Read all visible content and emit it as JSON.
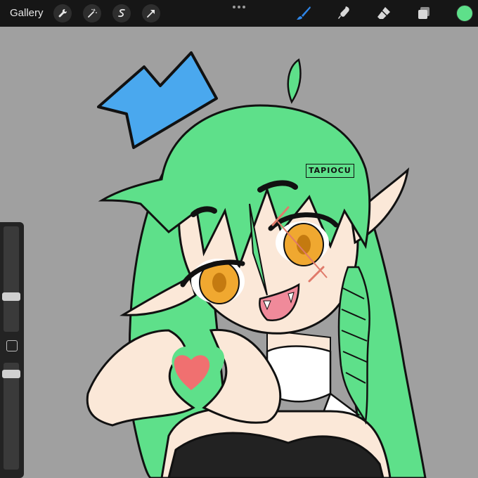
{
  "topbar": {
    "gallery_label": "Gallery",
    "left_tools": [
      {
        "icon": "wrench-icon"
      },
      {
        "icon": "magic-wand-icon"
      },
      {
        "icon": "selection-icon"
      },
      {
        "icon": "transform-arrow-icon"
      }
    ],
    "right_tools": [
      {
        "icon": "brush-icon",
        "active": true
      },
      {
        "icon": "smudge-icon",
        "active": false
      },
      {
        "icon": "eraser-icon",
        "active": false
      },
      {
        "icon": "layers-icon",
        "active": false
      }
    ],
    "current_color": "#5ee08a",
    "active_tool_color": "#2f86e8"
  },
  "canvas": {
    "background": "#a0a0a0",
    "artwork": {
      "description_colors": {
        "hair": "#5ee08a",
        "crown": "#4aa8ee",
        "skin": "#fbe8d8",
        "eyes": "#f0a830",
        "heart": "#f07070",
        "mouth": "#f08a9a"
      },
      "watermark_text": "TAPIOCU"
    }
  },
  "sidebar": {
    "size_slider_value": 0.25,
    "opacity_slider_value": 0.05
  }
}
